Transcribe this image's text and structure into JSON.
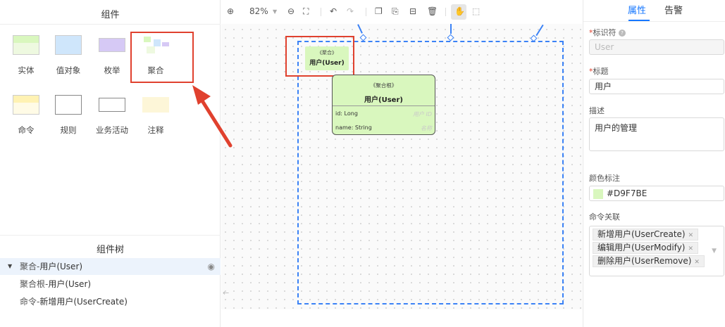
{
  "components": {
    "title": "组件",
    "items": [
      {
        "label": "实体"
      },
      {
        "label": "值对象"
      },
      {
        "label": "枚举"
      },
      {
        "label": "聚合"
      },
      {
        "label": "命令"
      },
      {
        "label": "规则"
      },
      {
        "label": "业务活动"
      },
      {
        "label": "注释"
      }
    ]
  },
  "tree": {
    "title": "组件树",
    "rows": [
      {
        "prefix": "聚合-",
        "name": "用户(User)",
        "selected": true
      },
      {
        "prefix": "聚合根-",
        "name": "用户(User)"
      },
      {
        "prefix": "命令-",
        "name": "新增用户(UserCreate)"
      }
    ]
  },
  "toolbar": {
    "zoom": "82%",
    "icons": [
      "zoom-in-icon",
      "chevron-down-icon",
      "zoom-out-icon",
      "fit-screen-icon",
      "undo-icon",
      "redo-icon",
      "copy-icon",
      "paste-icon",
      "lock-icon",
      "delete-icon",
      "hand-icon",
      "select-icon"
    ]
  },
  "canvas": {
    "aggregate": {
      "stereotype": "《聚合》",
      "name": "用户(User)",
      "color": "#D9F7BE"
    },
    "root": {
      "stereotype": "《聚合根》",
      "name": "用户(User)",
      "fields": [
        {
          "text": "id: Long",
          "note": "用户 ID"
        },
        {
          "text": "name: String",
          "note": "名称"
        }
      ]
    }
  },
  "properties": {
    "tabs": [
      {
        "label": "属性",
        "active": true
      },
      {
        "label": "告警"
      }
    ],
    "identifier": {
      "label": "标识符",
      "placeholder": "User"
    },
    "title": {
      "label": "标题",
      "value": "用户"
    },
    "description": {
      "label": "描述",
      "value": "用户的管理"
    },
    "color": {
      "label": "颜色标注",
      "value": "#D9F7BE"
    },
    "commands": {
      "label": "命令关联",
      "tags": [
        "新增用户(UserCreate)",
        "编辑用户(UserModify)",
        "删除用户(UserRemove)"
      ]
    }
  },
  "colors": {
    "accent": "#1677ff",
    "highlight": "#e0412e",
    "aggregate": "#D9F7BE"
  }
}
